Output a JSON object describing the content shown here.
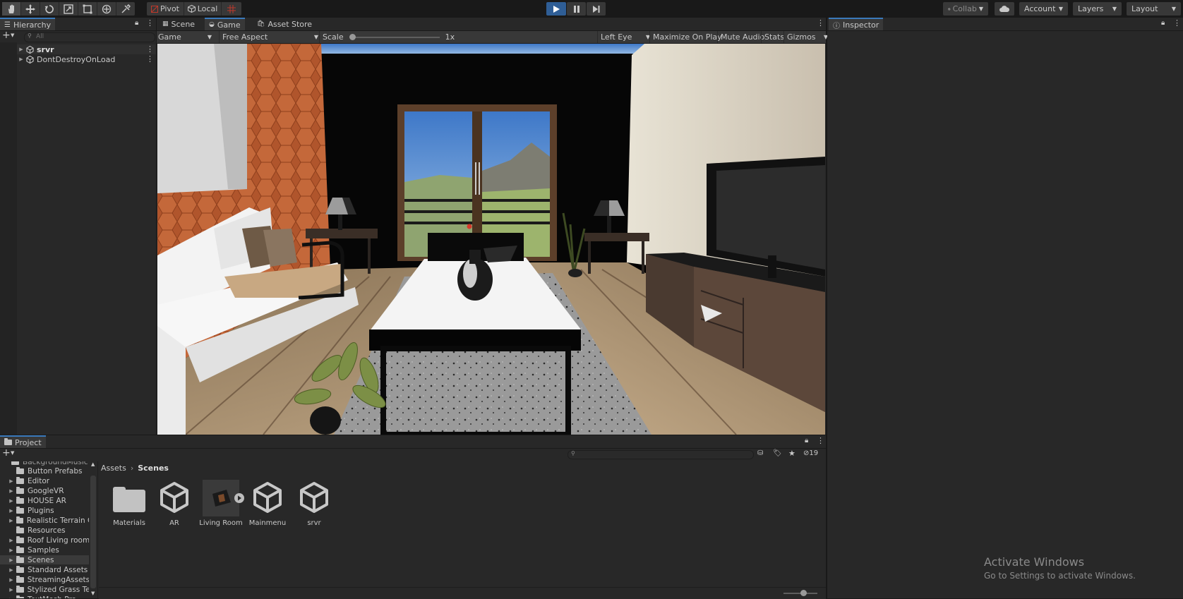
{
  "toolbar": {
    "tools": [
      "hand-tool",
      "move-tool",
      "rotate-tool",
      "scale-tool",
      "rect-tool",
      "transform-tool",
      "custom-tool"
    ],
    "pivot": "Pivot",
    "local": "Local",
    "collab": "Collab",
    "account": "Account",
    "layers": "Layers",
    "layout": "Layout"
  },
  "hierarchy": {
    "title": "Hierarchy",
    "search_placeholder": "All",
    "items": [
      {
        "label": "srvr"
      },
      {
        "label": "DontDestroyOnLoad"
      }
    ]
  },
  "center_tabs": {
    "scene": "Scene",
    "game": "Game",
    "asset_store": "Asset Store"
  },
  "game_toolbar": {
    "display": "Game",
    "aspect": "Free Aspect",
    "scale_label": "Scale",
    "scale_value": "1x",
    "scale_level": 0.0,
    "eye": "Left Eye",
    "maximize": "Maximize On Play",
    "mute": "Mute Audio",
    "stats": "Stats",
    "gizmos": "Gizmos"
  },
  "inspector": {
    "title": "Inspector"
  },
  "project": {
    "title": "Project",
    "hidden_count": "19",
    "folders": [
      {
        "label": "Button Prefabs",
        "expandable": false
      },
      {
        "label": "Editor",
        "expandable": true
      },
      {
        "label": "GoogleVR",
        "expandable": true
      },
      {
        "label": "HOUSE AR",
        "expandable": true
      },
      {
        "label": "Plugins",
        "expandable": true
      },
      {
        "label": "Realistic Terrain C",
        "expandable": true
      },
      {
        "label": "Resources",
        "expandable": false
      },
      {
        "label": "Roof Living room",
        "expandable": true
      },
      {
        "label": "Samples",
        "expandable": true
      },
      {
        "label": "Scenes",
        "expandable": true
      },
      {
        "label": "Standard Assets",
        "expandable": true
      },
      {
        "label": "StreamingAssets",
        "expandable": true
      },
      {
        "label": "Stylized Grass Te",
        "expandable": true
      },
      {
        "label": "TextMesh Pro",
        "expandable": true
      }
    ],
    "breadcrumb": [
      "Assets",
      "Scenes"
    ],
    "assets": [
      {
        "label": "Materials",
        "kind": "folder"
      },
      {
        "label": "AR",
        "kind": "unity-scene"
      },
      {
        "label": "Living Room",
        "kind": "prefab"
      },
      {
        "label": "Mainmenu",
        "kind": "unity-scene"
      },
      {
        "label": "srvr",
        "kind": "unity-scene"
      }
    ]
  },
  "watermark": {
    "line1": "Activate Windows",
    "line2": "Go to Settings to activate Windows."
  },
  "colors": {
    "accent": "#3a79bb",
    "play_active": "#2f5e96"
  }
}
